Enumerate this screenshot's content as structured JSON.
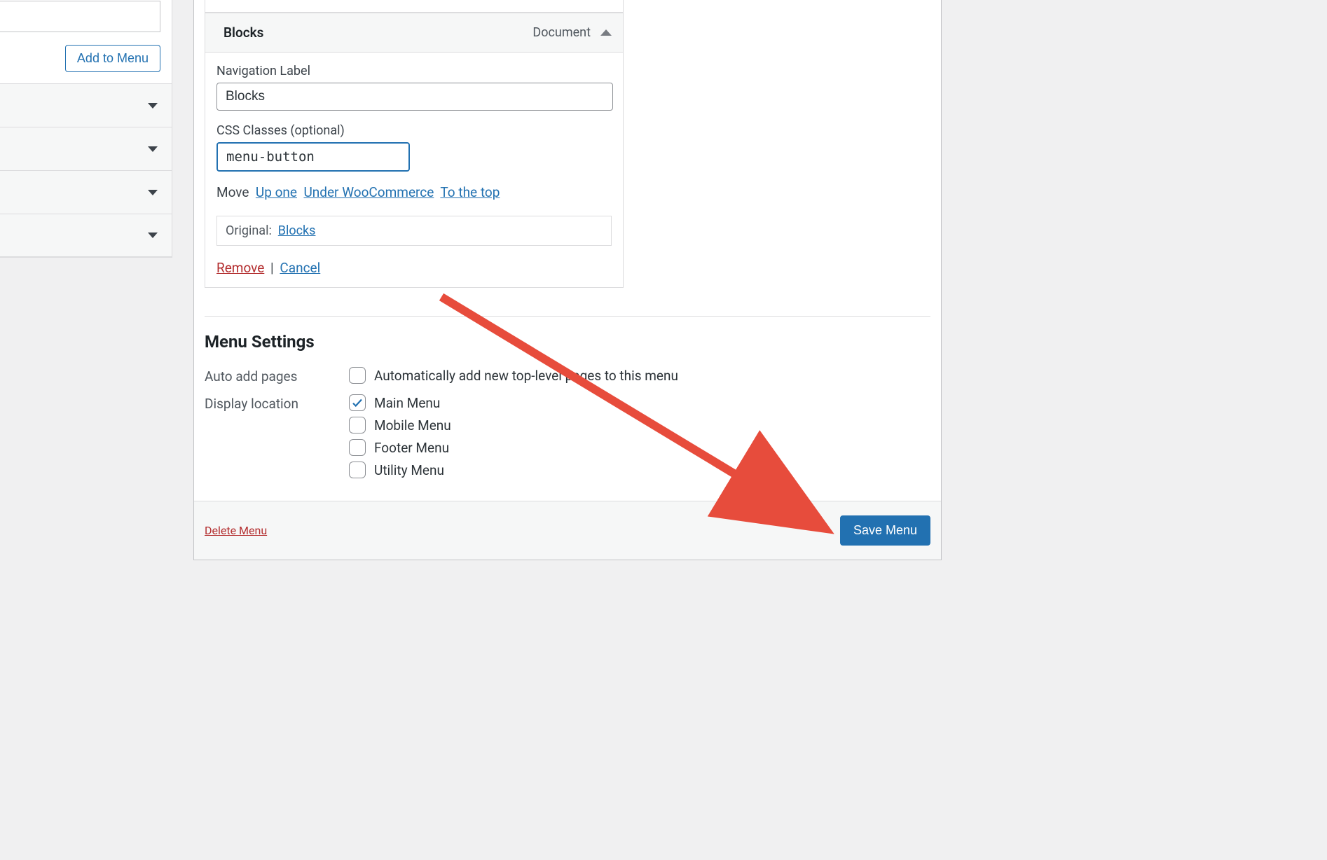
{
  "sidebar": {
    "add_to_menu_label": "Add to Menu"
  },
  "menu_item": {
    "title": "Blocks",
    "type_label": "Document",
    "nav_label_field_label": "Navigation Label",
    "nav_label_value": "Blocks",
    "css_classes_field_label": "CSS Classes (optional)",
    "css_classes_value": "menu-button",
    "move_label": "Move",
    "move_up": "Up one",
    "move_under": "Under WooCommerce",
    "move_top": "To the top",
    "original_label": "Original:",
    "original_link": "Blocks",
    "remove_label": "Remove",
    "cancel_label": "Cancel"
  },
  "settings": {
    "heading": "Menu Settings",
    "auto_add_label": "Auto add pages",
    "auto_add_option": "Automatically add new top-level pages to this menu",
    "auto_add_checked": false,
    "display_location_label": "Display location",
    "locations": [
      {
        "label": "Main Menu",
        "checked": true
      },
      {
        "label": "Mobile Menu",
        "checked": false
      },
      {
        "label": "Footer Menu",
        "checked": false
      },
      {
        "label": "Utility Menu",
        "checked": false
      }
    ]
  },
  "footer": {
    "delete_label": "Delete Menu",
    "save_label": "Save Menu"
  }
}
